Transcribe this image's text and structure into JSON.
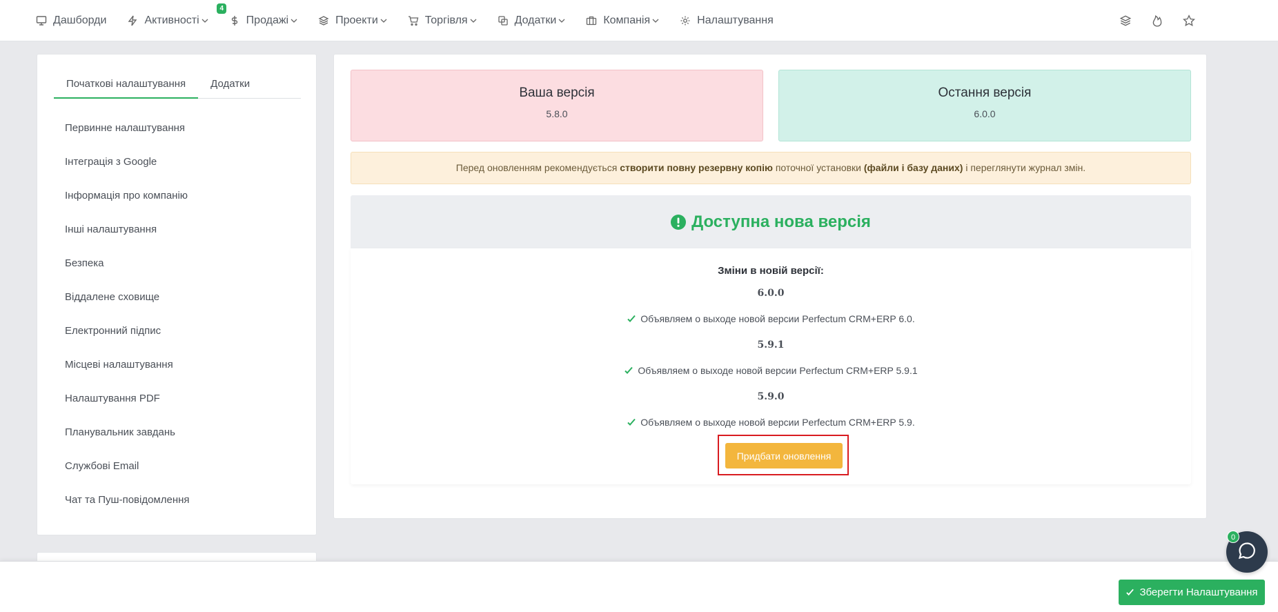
{
  "nav": {
    "items": [
      {
        "label": "Дашборди",
        "icon": "monitor-icon",
        "dropdown": false
      },
      {
        "label": "Активності",
        "icon": "bolt-icon",
        "dropdown": true,
        "badge": "4"
      },
      {
        "label": "Продажі",
        "icon": "dollar-icon",
        "dropdown": true
      },
      {
        "label": "Проекти",
        "icon": "layers-icon",
        "dropdown": true
      },
      {
        "label": "Торгівля",
        "icon": "cart-icon",
        "dropdown": true
      },
      {
        "label": "Додатки",
        "icon": "copy-icon",
        "dropdown": true
      },
      {
        "label": "Компанія",
        "icon": "briefcase-icon",
        "dropdown": true
      },
      {
        "label": "Налаштування",
        "icon": "gear-icon",
        "dropdown": false
      }
    ],
    "right_icons": [
      "layers-icon",
      "flame-icon",
      "star-icon"
    ]
  },
  "sidebar": {
    "tabs": [
      "Початкові налаштування",
      "Додатки"
    ],
    "active_tab": "Початкові налаштування",
    "items": [
      "Первинне налаштування",
      "Інтеграція з Google",
      "Інформація про компанію",
      "Інші налаштування",
      "Безпека",
      "Віддалене сховище",
      "Електронний підпис",
      "Місцеві налаштування",
      "Налаштування PDF",
      "Планувальник завдань",
      "Службові Email",
      "Чат та Пуш-повідомлення"
    ]
  },
  "versions": {
    "yours_title": "Ваша версія",
    "yours_number": "5.8.0",
    "latest_title": "Остання версія",
    "latest_number": "6.0.0"
  },
  "warning": {
    "part1": "Перед оновленням рекомендується ",
    "bold1": "створити повну резервну копію",
    "part2": " поточної установки ",
    "bold2": "(файли і базу даних)",
    "part3": " і переглянути журнал змін."
  },
  "update": {
    "heading": "Доступна нова версія",
    "changes_title": "Зміни в новій версії:",
    "releases": [
      {
        "version": "6.0.0",
        "note": "Объявляем о выходе новой версии Perfectum CRM+ERP 6.0."
      },
      {
        "version": "5.9.1",
        "note": "Объявляем о выходе новой версии Perfectum CRM+ERP 5.9.1"
      },
      {
        "version": "5.9.0",
        "note": "Объявляем о выходе новой версии Perfectum CRM+ERP 5.9."
      }
    ],
    "buy_label": "Придбати оновлення"
  },
  "footer": {
    "save_label": "Зберегти Налаштування"
  },
  "chat": {
    "badge": "0"
  },
  "colors": {
    "accent_green": "#2bb05f",
    "buy_orange": "#f3b63d",
    "highlight_red": "#d81b20"
  }
}
